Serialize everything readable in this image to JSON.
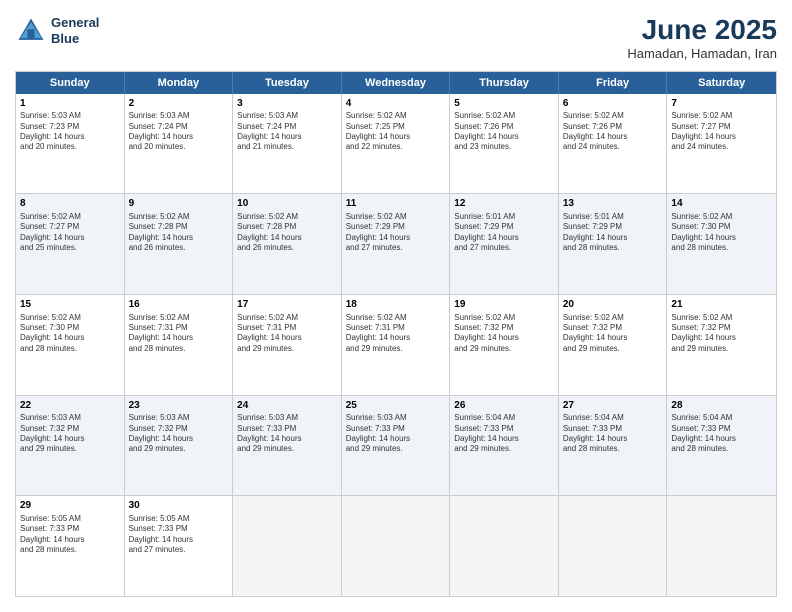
{
  "logo": {
    "line1": "General",
    "line2": "Blue"
  },
  "title": "June 2025",
  "location": "Hamadan, Hamadan, Iran",
  "header": {
    "days": [
      "Sunday",
      "Monday",
      "Tuesday",
      "Wednesday",
      "Thursday",
      "Friday",
      "Saturday"
    ]
  },
  "rows": [
    {
      "alt": false,
      "cells": [
        {
          "day": "1",
          "lines": [
            "Sunrise: 5:03 AM",
            "Sunset: 7:23 PM",
            "Daylight: 14 hours",
            "and 20 minutes."
          ]
        },
        {
          "day": "2",
          "lines": [
            "Sunrise: 5:03 AM",
            "Sunset: 7:24 PM",
            "Daylight: 14 hours",
            "and 20 minutes."
          ]
        },
        {
          "day": "3",
          "lines": [
            "Sunrise: 5:03 AM",
            "Sunset: 7:24 PM",
            "Daylight: 14 hours",
            "and 21 minutes."
          ]
        },
        {
          "day": "4",
          "lines": [
            "Sunrise: 5:02 AM",
            "Sunset: 7:25 PM",
            "Daylight: 14 hours",
            "and 22 minutes."
          ]
        },
        {
          "day": "5",
          "lines": [
            "Sunrise: 5:02 AM",
            "Sunset: 7:26 PM",
            "Daylight: 14 hours",
            "and 23 minutes."
          ]
        },
        {
          "day": "6",
          "lines": [
            "Sunrise: 5:02 AM",
            "Sunset: 7:26 PM",
            "Daylight: 14 hours",
            "and 24 minutes."
          ]
        },
        {
          "day": "7",
          "lines": [
            "Sunrise: 5:02 AM",
            "Sunset: 7:27 PM",
            "Daylight: 14 hours",
            "and 24 minutes."
          ]
        }
      ]
    },
    {
      "alt": true,
      "cells": [
        {
          "day": "8",
          "lines": [
            "Sunrise: 5:02 AM",
            "Sunset: 7:27 PM",
            "Daylight: 14 hours",
            "and 25 minutes."
          ]
        },
        {
          "day": "9",
          "lines": [
            "Sunrise: 5:02 AM",
            "Sunset: 7:28 PM",
            "Daylight: 14 hours",
            "and 26 minutes."
          ]
        },
        {
          "day": "10",
          "lines": [
            "Sunrise: 5:02 AM",
            "Sunset: 7:28 PM",
            "Daylight: 14 hours",
            "and 26 minutes."
          ]
        },
        {
          "day": "11",
          "lines": [
            "Sunrise: 5:02 AM",
            "Sunset: 7:29 PM",
            "Daylight: 14 hours",
            "and 27 minutes."
          ]
        },
        {
          "day": "12",
          "lines": [
            "Sunrise: 5:01 AM",
            "Sunset: 7:29 PM",
            "Daylight: 14 hours",
            "and 27 minutes."
          ]
        },
        {
          "day": "13",
          "lines": [
            "Sunrise: 5:01 AM",
            "Sunset: 7:29 PM",
            "Daylight: 14 hours",
            "and 28 minutes."
          ]
        },
        {
          "day": "14",
          "lines": [
            "Sunrise: 5:02 AM",
            "Sunset: 7:30 PM",
            "Daylight: 14 hours",
            "and 28 minutes."
          ]
        }
      ]
    },
    {
      "alt": false,
      "cells": [
        {
          "day": "15",
          "lines": [
            "Sunrise: 5:02 AM",
            "Sunset: 7:30 PM",
            "Daylight: 14 hours",
            "and 28 minutes."
          ]
        },
        {
          "day": "16",
          "lines": [
            "Sunrise: 5:02 AM",
            "Sunset: 7:31 PM",
            "Daylight: 14 hours",
            "and 28 minutes."
          ]
        },
        {
          "day": "17",
          "lines": [
            "Sunrise: 5:02 AM",
            "Sunset: 7:31 PM",
            "Daylight: 14 hours",
            "and 29 minutes."
          ]
        },
        {
          "day": "18",
          "lines": [
            "Sunrise: 5:02 AM",
            "Sunset: 7:31 PM",
            "Daylight: 14 hours",
            "and 29 minutes."
          ]
        },
        {
          "day": "19",
          "lines": [
            "Sunrise: 5:02 AM",
            "Sunset: 7:32 PM",
            "Daylight: 14 hours",
            "and 29 minutes."
          ]
        },
        {
          "day": "20",
          "lines": [
            "Sunrise: 5:02 AM",
            "Sunset: 7:32 PM",
            "Daylight: 14 hours",
            "and 29 minutes."
          ]
        },
        {
          "day": "21",
          "lines": [
            "Sunrise: 5:02 AM",
            "Sunset: 7:32 PM",
            "Daylight: 14 hours",
            "and 29 minutes."
          ]
        }
      ]
    },
    {
      "alt": true,
      "cells": [
        {
          "day": "22",
          "lines": [
            "Sunrise: 5:03 AM",
            "Sunset: 7:32 PM",
            "Daylight: 14 hours",
            "and 29 minutes."
          ]
        },
        {
          "day": "23",
          "lines": [
            "Sunrise: 5:03 AM",
            "Sunset: 7:32 PM",
            "Daylight: 14 hours",
            "and 29 minutes."
          ]
        },
        {
          "day": "24",
          "lines": [
            "Sunrise: 5:03 AM",
            "Sunset: 7:33 PM",
            "Daylight: 14 hours",
            "and 29 minutes."
          ]
        },
        {
          "day": "25",
          "lines": [
            "Sunrise: 5:03 AM",
            "Sunset: 7:33 PM",
            "Daylight: 14 hours",
            "and 29 minutes."
          ]
        },
        {
          "day": "26",
          "lines": [
            "Sunrise: 5:04 AM",
            "Sunset: 7:33 PM",
            "Daylight: 14 hours",
            "and 29 minutes."
          ]
        },
        {
          "day": "27",
          "lines": [
            "Sunrise: 5:04 AM",
            "Sunset: 7:33 PM",
            "Daylight: 14 hours",
            "and 28 minutes."
          ]
        },
        {
          "day": "28",
          "lines": [
            "Sunrise: 5:04 AM",
            "Sunset: 7:33 PM",
            "Daylight: 14 hours",
            "and 28 minutes."
          ]
        }
      ]
    },
    {
      "alt": false,
      "cells": [
        {
          "day": "29",
          "lines": [
            "Sunrise: 5:05 AM",
            "Sunset: 7:33 PM",
            "Daylight: 14 hours",
            "and 28 minutes."
          ]
        },
        {
          "day": "30",
          "lines": [
            "Sunrise: 5:05 AM",
            "Sunset: 7:33 PM",
            "Daylight: 14 hours",
            "and 27 minutes."
          ]
        },
        {
          "day": "",
          "lines": []
        },
        {
          "day": "",
          "lines": []
        },
        {
          "day": "",
          "lines": []
        },
        {
          "day": "",
          "lines": []
        },
        {
          "day": "",
          "lines": []
        }
      ]
    }
  ]
}
